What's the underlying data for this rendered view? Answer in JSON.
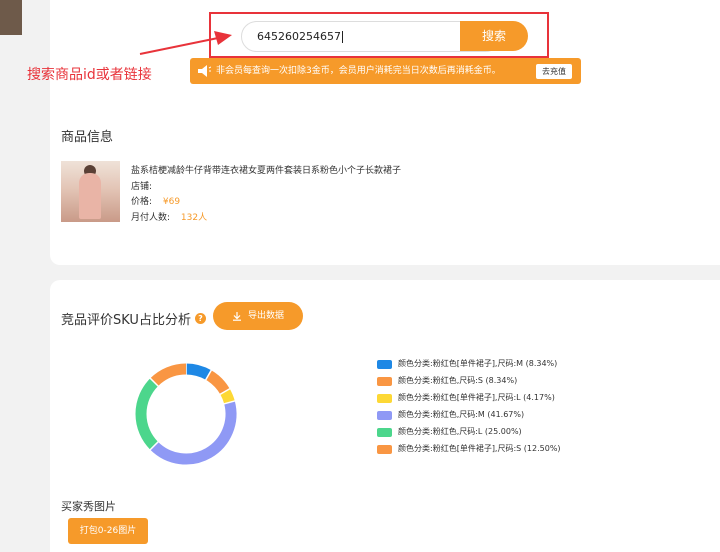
{
  "search": {
    "value": "645260254657",
    "button_label": "搜索"
  },
  "annotation": {
    "text": "搜索商品id或者链接"
  },
  "notice": {
    "text": "非会员每查询一次扣除3金币，会员用户消耗完当日次数后再消耗金币。",
    "recharge_label": "去充值"
  },
  "product": {
    "section_title": "商品信息",
    "name": "盐系桔梗减龄牛仔背带连衣裙女夏两件套装日系粉色小个子长款裙子",
    "shop_label": "店铺:",
    "price_label": "价格:",
    "price_value": "¥69",
    "monthly_label": "月付人数:",
    "monthly_value": "132人"
  },
  "analysis": {
    "title": "竞品评价SKU占比分析",
    "help_icon": "question-icon",
    "export_label": "导出数据",
    "export_icon": "download-icon"
  },
  "chart_data": {
    "type": "pie",
    "title": "",
    "series": [
      {
        "name": "颜色分类:粉红色[单件裙子],尺码:M (8.34%)",
        "value": 8.34,
        "color": "#1e88e5"
      },
      {
        "name": "颜色分类:粉红色,尺码:S (8.34%)",
        "value": 8.34,
        "color": "#f99643"
      },
      {
        "name": "颜色分类:粉红色[单件裙子],尺码:L (4.17%)",
        "value": 4.17,
        "color": "#fdd835"
      },
      {
        "name": "颜色分类:粉红色,尺码:M (41.67%)",
        "value": 41.67,
        "color": "#8f99f5"
      },
      {
        "name": "颜色分类:粉红色,尺码:L (25.00%)",
        "value": 25.0,
        "color": "#4cd68c"
      },
      {
        "name": "颜色分类:粉红色[单件裙子],尺码:S (12.50%)",
        "value": 12.5,
        "color": "#f99643"
      }
    ],
    "legend_position": "right"
  },
  "buyer_show": {
    "title": "买家秀图片",
    "pack_label": "打包0-26图片"
  },
  "colors": {
    "accent": "#f69a2a",
    "annotation_red": "#e8333a"
  }
}
